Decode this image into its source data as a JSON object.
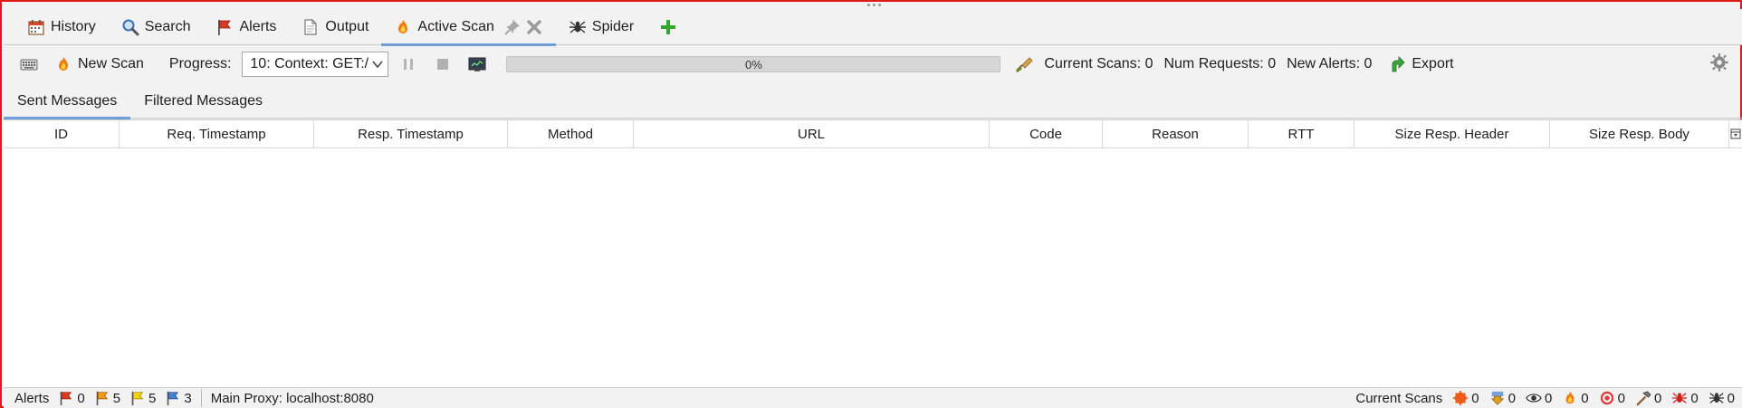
{
  "tabs": [
    {
      "label": "History",
      "icon": "calendar-icon"
    },
    {
      "label": "Search",
      "icon": "magnifier-icon"
    },
    {
      "label": "Alerts",
      "icon": "red-flag-icon"
    },
    {
      "label": "Output",
      "icon": "document-icon"
    },
    {
      "label": "Active Scan",
      "icon": "flame-icon",
      "active": true
    },
    {
      "label": "Spider",
      "icon": "spider-icon"
    }
  ],
  "toolbar": {
    "new_scan_label": "New Scan",
    "progress_label": "Progress:",
    "progress_select_value": "10: Context: GET:/",
    "progress_value": 0,
    "progress_text": "0%",
    "current_scans_label": "Current Scans:",
    "current_scans_value": "0",
    "num_requests_label": "Num Requests:",
    "num_requests_value": "0",
    "new_alerts_label": "New Alerts:",
    "new_alerts_value": "0",
    "export_label": "Export"
  },
  "subtabs": [
    {
      "label": "Sent Messages",
      "active": true
    },
    {
      "label": "Filtered Messages"
    }
  ],
  "table": {
    "columns": [
      "ID",
      "Req. Timestamp",
      "Resp. Timestamp",
      "Method",
      "URL",
      "Code",
      "Reason",
      "RTT",
      "Size Resp. Header",
      "Size Resp. Body"
    ],
    "rows": []
  },
  "statusbar": {
    "alerts_label": "Alerts",
    "alert_counts": [
      {
        "icon": "high-alert-flag-icon",
        "color": "#d83a22",
        "value": "0"
      },
      {
        "icon": "medium-alert-flag-icon",
        "color": "#f09a1a",
        "value": "5"
      },
      {
        "icon": "low-alert-flag-icon",
        "color": "#f5d20f",
        "value": "5"
      },
      {
        "icon": "info-alert-flag-icon",
        "color": "#4b7fd1",
        "value": "3"
      }
    ],
    "proxy_text": "Main Proxy: localhost:8080",
    "current_scans_label": "Current Scans",
    "scan_counts": [
      {
        "icon": "spider-ajax-icon",
        "value": "0"
      },
      {
        "icon": "download-arrow-icon",
        "value": "0"
      },
      {
        "icon": "eye-icon",
        "value": "0"
      },
      {
        "icon": "flame-icon",
        "value": "0"
      },
      {
        "icon": "target-icon",
        "value": "0"
      },
      {
        "icon": "hammer-icon",
        "value": "0"
      },
      {
        "icon": "red-spider-icon",
        "value": "0"
      },
      {
        "icon": "spider-icon",
        "value": "0"
      }
    ]
  }
}
